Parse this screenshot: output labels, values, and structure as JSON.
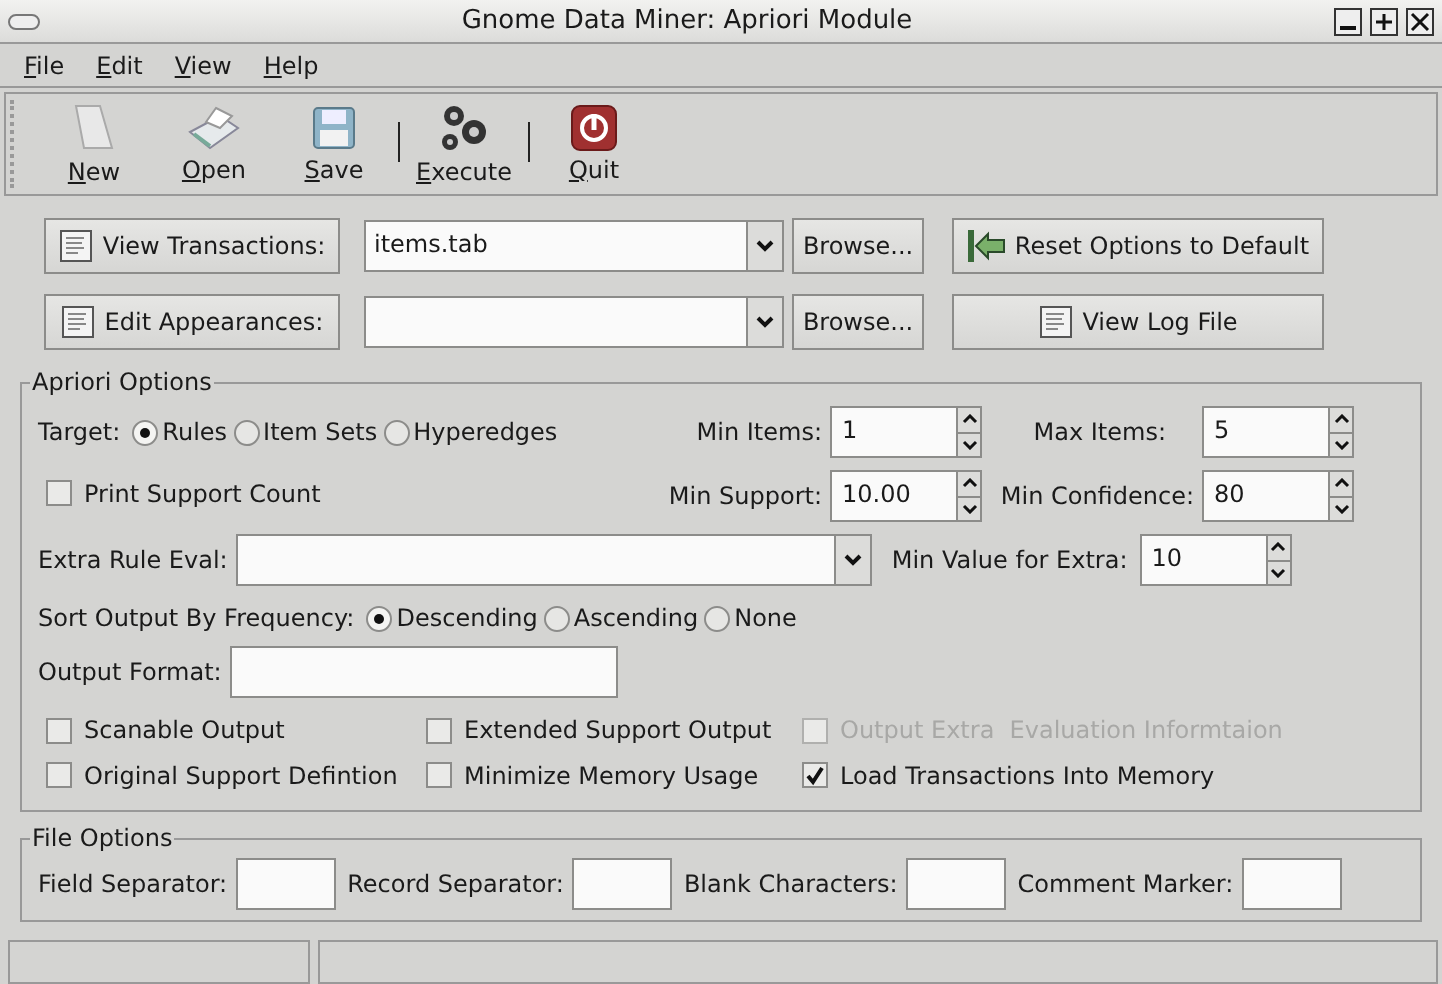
{
  "window": {
    "title": "Gnome Data Miner: Apriori Module"
  },
  "menu": [
    {
      "label": "File"
    },
    {
      "label": "Edit"
    },
    {
      "label": "View"
    },
    {
      "label": "Help"
    }
  ],
  "toolbar": [
    {
      "label": "New"
    },
    {
      "label": "Open"
    },
    {
      "label": "Save"
    },
    {
      "label": "Execute"
    },
    {
      "label": "Quit"
    }
  ],
  "file_rows": [
    {
      "button": "View Transactions:",
      "value": "items.tab",
      "browse": "Browse...",
      "action": "Reset Options to Default"
    },
    {
      "button": "Edit Appearances:",
      "browse": "Browse...",
      "action": "View Log File"
    }
  ],
  "apriori": {
    "title": "Apriori Options",
    "target": {
      "label": "Target:",
      "options": [
        {
          "label": "Rules",
          "selected": true
        },
        {
          "label": "Item Sets",
          "selected": false
        },
        {
          "label": "Hyperedges",
          "selected": false
        }
      ]
    },
    "print_support_count": {
      "label": "Print Support Count",
      "checked": false
    },
    "min_items": {
      "label": "Min Items:",
      "value": "1"
    },
    "max_items": {
      "label": "Max Items:",
      "value": "5"
    },
    "min_support": {
      "label": "Min Support:",
      "value": "10.00"
    },
    "min_confidence": {
      "label": "Min Confidence:",
      "value": "80"
    },
    "extra_rule_eval": {
      "label": "Extra Rule Eval:"
    },
    "min_value_for_extra": {
      "label": "Min Value for Extra:",
      "value": "10"
    },
    "sort_output": {
      "label": "Sort Output By Frequency:",
      "options": [
        {
          "label": "Descending",
          "selected": true
        },
        {
          "label": "Ascending",
          "selected": false
        },
        {
          "label": "None",
          "selected": false
        }
      ]
    },
    "output_format": {
      "label": "Output Format:"
    },
    "checkboxes": [
      {
        "label": "Scanable Output",
        "checked": false,
        "disabled": false
      },
      {
        "label": "Extended Support Output",
        "checked": false,
        "disabled": false
      },
      {
        "label": "Output Extra  Evaluation Informtaion",
        "checked": false,
        "disabled": true
      },
      {
        "label": "Original Support Defintion",
        "checked": false,
        "disabled": false
      },
      {
        "label": "Minimize Memory Usage",
        "checked": false,
        "disabled": false
      },
      {
        "label": "Load Transactions Into Memory",
        "checked": true,
        "disabled": false
      }
    ]
  },
  "file_options": {
    "title": "File Options",
    "fields": [
      {
        "label": "Field Separator:"
      },
      {
        "label": "Record Separator:"
      },
      {
        "label": "Blank Characters:"
      },
      {
        "label": "Comment Marker:"
      }
    ]
  }
}
